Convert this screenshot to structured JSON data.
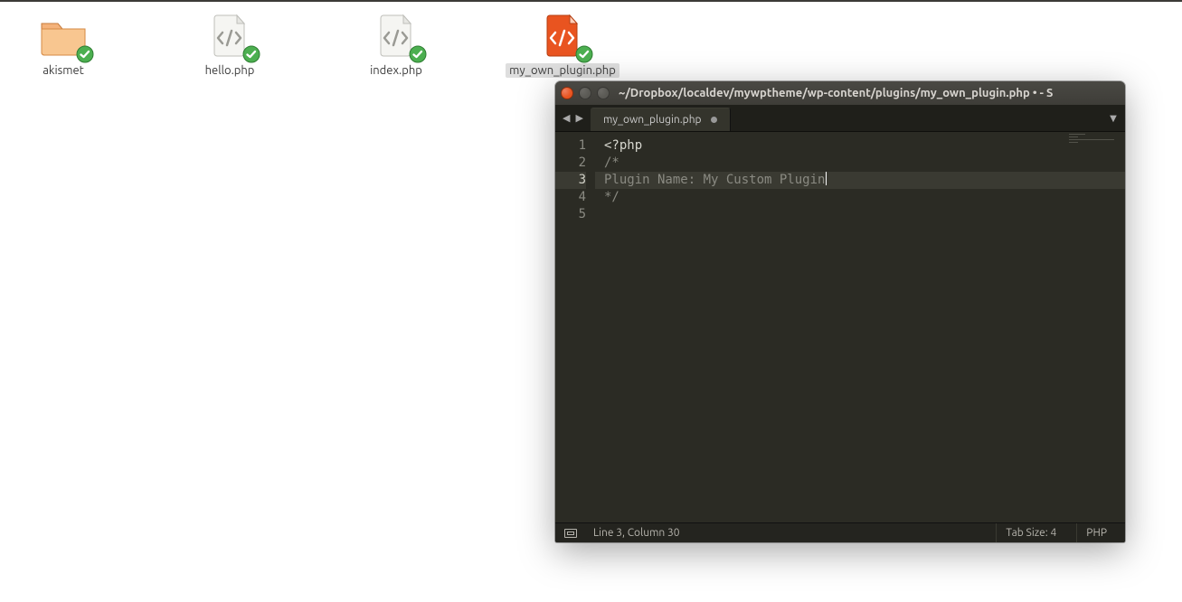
{
  "desktop": {
    "icons": [
      {
        "type": "folder",
        "label": "akismet",
        "selected": false,
        "synced": true
      },
      {
        "type": "php",
        "label": "hello.php",
        "selected": false,
        "synced": true
      },
      {
        "type": "php",
        "label": "index.php",
        "selected": false,
        "synced": true
      },
      {
        "type": "php-selected",
        "label": "my_own_plugin.php",
        "selected": true,
        "synced": true
      }
    ]
  },
  "editor": {
    "title": "~/Dropbox/localdev/mywptheme/wp-content/plugins/my_own_plugin.php • - S",
    "tab": {
      "name": "my_own_plugin.php",
      "dirty": true
    },
    "lines": [
      {
        "n": 1,
        "text": "<?php",
        "cls": "c-keyword"
      },
      {
        "n": 2,
        "text": "/*",
        "cls": "c-comment"
      },
      {
        "n": 3,
        "text": "Plugin Name: My Custom Plugin",
        "cls": "c-comment",
        "current": true
      },
      {
        "n": 4,
        "text": "*/",
        "cls": "c-comment"
      },
      {
        "n": 5,
        "text": "",
        "cls": ""
      }
    ],
    "status": {
      "pos": "Line 3, Column 30",
      "tabsize": "Tab Size: 4",
      "lang": "PHP"
    }
  }
}
